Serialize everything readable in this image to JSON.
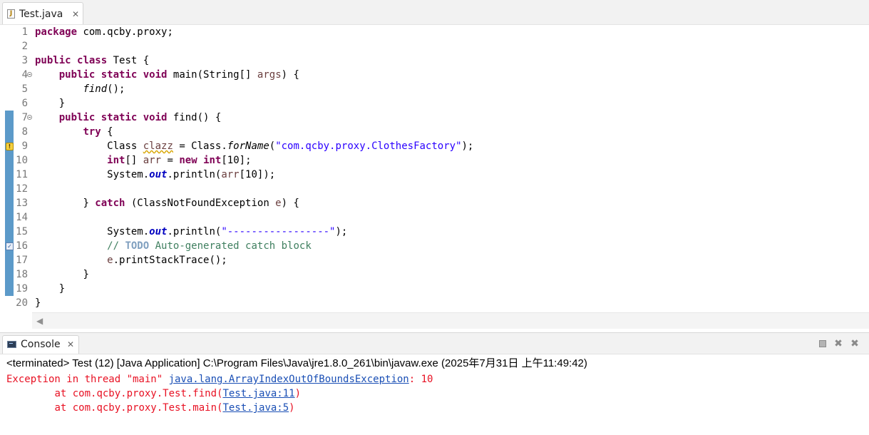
{
  "editor": {
    "tab": {
      "title": "Test.java",
      "icon": "java-file-icon",
      "close_glyph": "✕"
    },
    "line_numbers": [
      "1",
      "2",
      "3",
      "4",
      "5",
      "6",
      "7",
      "8",
      "9",
      "10",
      "11",
      "12",
      "13",
      "14",
      "15",
      "16",
      "17",
      "18",
      "19",
      "20"
    ],
    "code": {
      "l1": {
        "kw": "package",
        "rest": " com.qcby.proxy;"
      },
      "l3": {
        "kw1": "public",
        "kw2": "class",
        "rest": " Test {"
      },
      "l4": {
        "kw1": "public",
        "kw2": "static",
        "kw3": "void",
        "a": " main(String[] ",
        "var": "args",
        "b": ") {"
      },
      "l5": {
        "call": "find",
        "rest": "();"
      },
      "l6": {
        "text": "}"
      },
      "l7": {
        "kw1": "public",
        "kw2": "static",
        "kw3": "void",
        "rest": " find() {"
      },
      "l8": {
        "kw": "try",
        "rest": " {"
      },
      "l9": {
        "a": "Class ",
        "var": "clazz",
        "b": " = Class.",
        "method": "forName",
        "c": "(",
        "str": "\"com.qcby.proxy.ClothesFactory\"",
        "d": ");"
      },
      "l10": {
        "kw1": "int",
        "a": "[] ",
        "var": "arr",
        "b": " = ",
        "kw2": "new",
        "c": " ",
        "kw3": "int",
        "d": "[10];"
      },
      "l11": {
        "a": "System.",
        "field": "out",
        "b": ".println(",
        "var": "arr",
        "c": "[10]);"
      },
      "l13": {
        "a": "} ",
        "kw": "catch",
        "b": " (ClassNotFoundException ",
        "var": "e",
        "c": ") {"
      },
      "l15": {
        "a": "System.",
        "field": "out",
        "b": ".println(",
        "str": "\"-----------------\"",
        "c": ");"
      },
      "l16": {
        "slashes": "// ",
        "todo": "TODO",
        "rest": " Auto-generated catch block"
      },
      "l17": {
        "var": "e",
        "rest": ".printStackTrace();"
      },
      "l18": {
        "text": "}"
      },
      "l19": {
        "text": "}"
      },
      "l20": {
        "text": "}"
      }
    },
    "scroll_left_glyph": "◀"
  },
  "console": {
    "tab": {
      "title": "Console",
      "icon": "console-icon",
      "close_glyph": "✕"
    },
    "toolbar": {
      "terminate_icon": "terminate-icon",
      "remove_launch": "✖",
      "remove_all": "✖"
    },
    "status": "<terminated> Test (12) [Java Application] C:\\Program Files\\Java\\jre1.8.0_261\\bin\\javaw.exe (2025年7月31日 上午11:49:42)",
    "output": {
      "line1": {
        "prefix": "Exception in thread \"main\" ",
        "link": "java.lang.ArrayIndexOutOfBoundsException",
        "suffix": ": 10"
      },
      "line2": {
        "prefix": "\tat com.qcby.proxy.Test.find(",
        "link": "Test.java:11",
        "suffix": ")"
      },
      "line3": {
        "prefix": "\tat com.qcby.proxy.Test.main(",
        "link": "Test.java:5",
        "suffix": ")"
      }
    },
    "colors": {
      "error": "#e81123",
      "link": "#1a4fb5"
    }
  },
  "syntax_colors": {
    "keyword": "#7f0055",
    "string": "#2a00ff",
    "comment": "#3f7f5f",
    "todo": "#7f9fbf",
    "local_var": "#6a3e3e",
    "field": "#0000c0"
  }
}
